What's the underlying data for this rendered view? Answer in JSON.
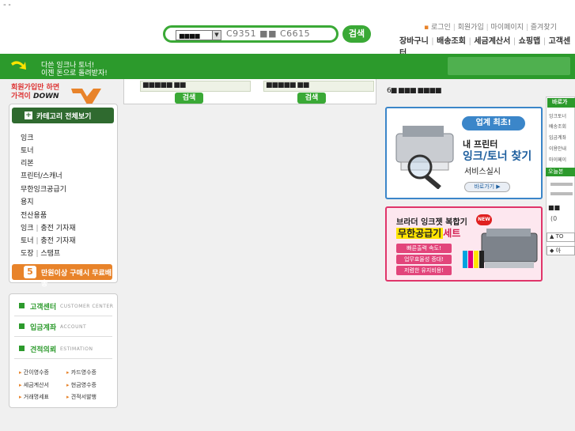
{
  "corner_mark": "\" \"",
  "search": {
    "select_value": "■■■■",
    "query": "C9351 ■■ C6615",
    "button": "검색"
  },
  "util_links": [
    "로그인",
    "회원가입",
    "마이페이지",
    "즐겨찾기"
  ],
  "nav_links": [
    "장바구니",
    "배송조회",
    "세금계산서",
    "쇼핑맵",
    "고객센터"
  ],
  "slogan": {
    "line1": "다쓴 잉크나 토너!",
    "line2": "이젠 돈으로 돌려받자!"
  },
  "promo": {
    "line1": "회원가입만 하면",
    "line2a": "가격이",
    "line2b": "DOWN"
  },
  "strip": {
    "inputs": [
      "■■■■■ ■■",
      "■■■■■ ■■"
    ],
    "buttons": [
      "검색",
      "검색"
    ]
  },
  "categories": {
    "header": "카테고리 전체보기",
    "items": [
      {
        "a": "잉크",
        "b": ""
      },
      {
        "a": "토너",
        "b": ""
      },
      {
        "a": "리본",
        "b": ""
      },
      {
        "a": "프린터/스캐너",
        "b": ""
      },
      {
        "a": "무한잉크공급기",
        "b": ""
      },
      {
        "a": "용지",
        "b": ""
      },
      {
        "a": "전산용품",
        "b": ""
      },
      {
        "a": "잉크",
        "b": "충전 기자재"
      },
      {
        "a": "토너",
        "b": "충전 기자재"
      },
      {
        "a": "도장",
        "b": "스탬프"
      }
    ]
  },
  "free_shipping": {
    "num": "5",
    "label": "만원이상 구매시 무료배송"
  },
  "services": [
    {
      "kr": "고객센터",
      "en": "CUSTOMER CENTER"
    },
    {
      "kr": "입금계좌",
      "en": "ACCOUNT"
    },
    {
      "kr": "견적의뢰",
      "en": "ESTIMATION"
    }
  ],
  "sublinks": [
    "간이영수증",
    "카드영수증",
    "세금계산서",
    "현금영수증",
    "거래명세표",
    "견적서발행"
  ],
  "right_title": "6■ ■■■ ■■■■",
  "banner1": {
    "badge": "업계 최초!",
    "line1": "내 프린터",
    "line2": "잉크/토너 찾기",
    "line3": "서비스실시",
    "button": "바로가기 ▶"
  },
  "banner2": {
    "line1": "브라더 잉크젯 복합기",
    "line2_hl": "무한공급기",
    "line2_tail": "세트",
    "badge": "NEW",
    "chips": [
      "빠른출력 속도!",
      "업무효율성 증대!",
      "저렴한 유지비용!"
    ]
  },
  "rail": {
    "header": "바로가",
    "items": [
      "잉크토너",
      "배송조회",
      "입금계좌",
      "이용안내",
      "마이페이"
    ],
    "today": "오늘본",
    "bottom_a": "(0",
    "btn1": "▲ TO",
    "btn2": "◆ 아"
  },
  "colors": {
    "brand_green": "#2c9a2c",
    "accent_orange": "#e8832a",
    "blue": "#3b86c9",
    "pink": "#e0356a"
  }
}
